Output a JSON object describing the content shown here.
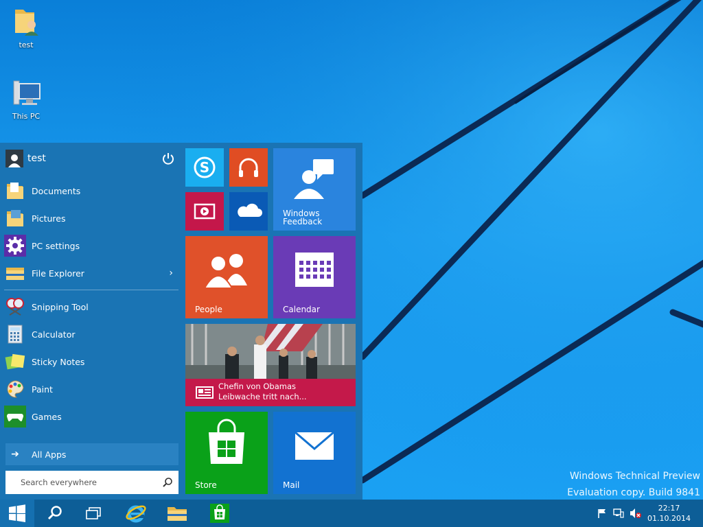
{
  "desktop": {
    "icons": [
      {
        "label": "test",
        "icon": "user-folder-icon"
      },
      {
        "label": "This PC",
        "icon": "computer-icon"
      }
    ],
    "watermark": {
      "line1": "Windows Technical Preview",
      "line2": "Evaluation copy. Build 9841"
    }
  },
  "start_menu": {
    "user": {
      "name": "test",
      "icon": "user-avatar-icon"
    },
    "power_icon": "power-icon",
    "places": [
      {
        "label": "Documents",
        "icon": "documents-folder-icon"
      },
      {
        "label": "Pictures",
        "icon": "pictures-folder-icon"
      },
      {
        "label": "PC settings",
        "icon": "gear-icon"
      },
      {
        "label": "File Explorer",
        "icon": "file-explorer-icon",
        "chevron": "›"
      }
    ],
    "apps": [
      {
        "label": "Snipping Tool",
        "icon": "snipping-tool-icon"
      },
      {
        "label": "Calculator",
        "icon": "calculator-icon"
      },
      {
        "label": "Sticky Notes",
        "icon": "sticky-notes-icon"
      },
      {
        "label": "Paint",
        "icon": "paint-palette-icon"
      },
      {
        "label": "Games",
        "icon": "games-controller-icon"
      }
    ],
    "all_apps": {
      "label": "All Apps",
      "arrow": "➔"
    },
    "search": {
      "placeholder": "Search everywhere",
      "value": ""
    },
    "tiles": {
      "skype": {
        "label": "",
        "color": "#1aaef0"
      },
      "music": {
        "label": "",
        "color": "#e04d23"
      },
      "video": {
        "label": "",
        "color": "#c4174a"
      },
      "onedrive": {
        "label": "",
        "color": "#0a5ab5"
      },
      "feedback": {
        "label_line1": "Windows",
        "label_line2": "Feedback",
        "color": "#2a84de"
      },
      "people": {
        "label": "People",
        "color": "#e0512a"
      },
      "calendar": {
        "label": "Calendar",
        "color": "#6a3bb6"
      },
      "news": {
        "caption_line1": "Chefin von Obamas",
        "caption_line2": "Leibwache tritt nach...",
        "color": "#c4194a"
      },
      "store": {
        "label": "Store",
        "color": "#0aa119"
      },
      "mail": {
        "label": "Mail",
        "color": "#1272d1"
      }
    }
  },
  "taskbar": {
    "buttons": [
      {
        "name": "start-button",
        "icon": "windows-logo-icon"
      },
      {
        "name": "search-button",
        "icon": "search-icon"
      },
      {
        "name": "task-view-button",
        "icon": "task-view-icon"
      },
      {
        "name": "internet-explorer-button",
        "icon": "internet-explorer-icon"
      },
      {
        "name": "file-explorer-button",
        "icon": "folder-icon"
      },
      {
        "name": "store-button",
        "icon": "store-bag-icon"
      }
    ],
    "tray_icons": [
      "action-center-flag-icon",
      "network-icon",
      "volume-muted-icon"
    ],
    "clock": {
      "time": "22:17",
      "date": "01.10.2014"
    }
  }
}
